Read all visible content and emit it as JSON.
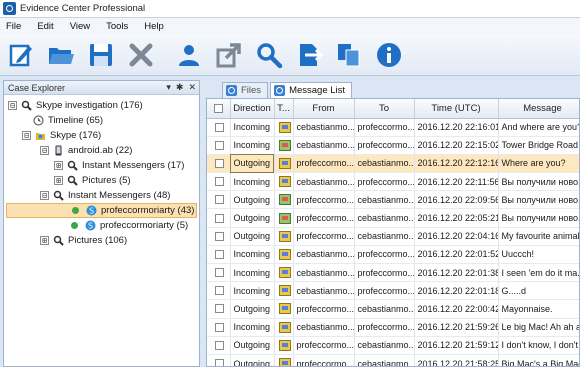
{
  "app": {
    "title": "Evidence Center Professional"
  },
  "menu": [
    "File",
    "Edit",
    "View",
    "Tools",
    "Help"
  ],
  "toolbar": {
    "buttons": [
      "new-case-icon",
      "open-case-icon",
      "save-icon",
      "delete-icon",
      "user-icon",
      "export-icon",
      "search-icon",
      "import-icon",
      "copy-icon",
      "info-icon"
    ],
    "accent": "#1f6fc4"
  },
  "case_explorer": {
    "header": "Case Explorer",
    "controls": [
      "▾",
      "✱",
      "✕"
    ],
    "tree": [
      {
        "label": "Skype investigation (176)",
        "exp": "⊟",
        "icon": "search"
      },
      {
        "label": "Timeline (65)",
        "exp": "",
        "icon": "clock"
      },
      {
        "label": "Skype (176)",
        "exp": "⊟",
        "icon": "skype-folder"
      },
      {
        "label": "android.ab (22)",
        "exp": "⊟",
        "icon": "phone"
      },
      {
        "label": "Instant Messengers (17)",
        "exp": "⊞",
        "icon": "search"
      },
      {
        "label": "Pictures (5)",
        "exp": "⊞",
        "icon": "search"
      },
      {
        "label": "Instant Messengers (48)",
        "exp": "⊟",
        "icon": "search"
      },
      {
        "label": "profeccormoriarty (43)",
        "exp": "",
        "icon": "skype"
      },
      {
        "label": "profeccormoriarty (5)",
        "exp": "",
        "icon": "skype"
      },
      {
        "label": "Pictures (106)",
        "exp": "⊞",
        "icon": "search"
      }
    ]
  },
  "tabs": [
    "Files",
    "Message List"
  ],
  "message_list": {
    "columns": [
      "",
      "Direction",
      "T...",
      "From",
      "To",
      "Time (UTC)",
      "Message"
    ],
    "rows": [
      {
        "dir": "Incoming",
        "type": "msg",
        "from": "cebastianmo...",
        "to": "profeccormo...",
        "time": "2016.12.20 22:16:01",
        "msg": "And where are you?"
      },
      {
        "dir": "Incoming",
        "type": "pic",
        "from": "cebastianmo...",
        "to": "profeccormo...",
        "time": "2016.12.20 22:15:02",
        "msg": "Tower Bridge Road"
      },
      {
        "dir": "Outgoing",
        "type": "msg",
        "from": "profeccormo...",
        "to": "cebastianmo...",
        "time": "2016.12.20 22:12:16",
        "msg": "Where are you?",
        "selected": true
      },
      {
        "dir": "Incoming",
        "type": "msg",
        "from": "cebastianmo...",
        "to": "profeccormo...",
        "time": "2016.12.20 22:11:56",
        "msg": "Вы получили ново..."
      },
      {
        "dir": "Outgoing",
        "type": "pic",
        "from": "profeccormo...",
        "to": "cebastianmo...",
        "time": "2016.12.20 22:09:56",
        "msg": "Вы получили ново..."
      },
      {
        "dir": "Outgoing",
        "type": "pic",
        "from": "profeccormo...",
        "to": "cebastianmo...",
        "time": "2016.12.20 22:05:21",
        "msg": "Вы получили ново..."
      },
      {
        "dir": "Outgoing",
        "type": "msg",
        "from": "profeccormo...",
        "to": "cebastianmo...",
        "time": "2016.12.20 22:04:16",
        "msg": "My favourite animal"
      },
      {
        "dir": "Incoming",
        "type": "msg",
        "from": "cebastianmo...",
        "to": "profeccormo...",
        "time": "2016.12.20 22:01:52",
        "msg": "Uuccch!"
      },
      {
        "dir": "Incoming",
        "type": "msg",
        "from": "cebastianmo...",
        "to": "profeccormo...",
        "time": "2016.12.20 22:01:38",
        "msg": "I seen 'em do it ma..."
      },
      {
        "dir": "Incoming",
        "type": "msg",
        "from": "cebastianmo...",
        "to": "profeccormo...",
        "time": "2016.12.20 22:01:18",
        "msg": "G.....d"
      },
      {
        "dir": "Outgoing",
        "type": "msg",
        "from": "profeccormo...",
        "to": "cebastianmo...",
        "time": "2016.12.20 22:00:42",
        "msg": "Mayonnaise."
      },
      {
        "dir": "Incoming",
        "type": "msg",
        "from": "cebastianmo...",
        "to": "profeccormo...",
        "time": "2016.12.20 21:59:26",
        "msg": "Le big Mac! Ah ah ah"
      },
      {
        "dir": "Outgoing",
        "type": "msg",
        "from": "profeccormo...",
        "to": "cebastianmo...",
        "time": "2016.12.20 21:59:12",
        "msg": "I don't know, I don't"
      },
      {
        "dir": "Outgoing",
        "type": "msg",
        "from": "profeccormo...",
        "to": "cebastianmo...",
        "time": "2016.12.20 21:58:25",
        "msg": "Big Mac's a Big Mac"
      }
    ]
  }
}
